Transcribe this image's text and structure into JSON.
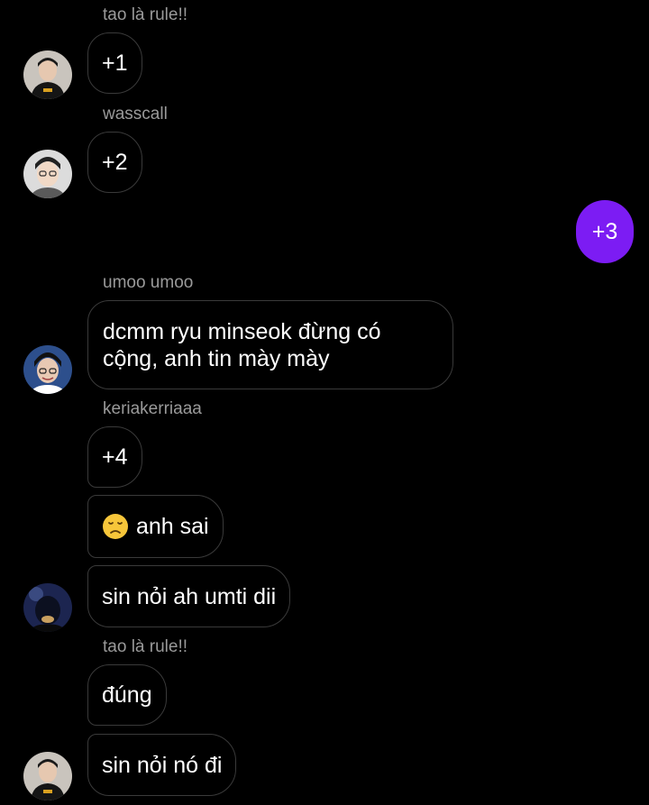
{
  "messages": [
    {
      "sender": "tao là rule!!",
      "text": "+1"
    },
    {
      "sender": "wasscall",
      "text": "+2"
    },
    {
      "outgoing": true,
      "text": "+3"
    },
    {
      "sender": "umoo umoo",
      "text": "dcmm ryu minseok đừng có cộng, anh tin mày mày"
    },
    {
      "sender": "keriakerriaaa",
      "texts": [
        "+4",
        "anh sai",
        "sin nỏi ah umti dii"
      ],
      "emoji": "disappointed-face-icon"
    },
    {
      "sender": "tao là rule!!",
      "texts": [
        "đúng",
        "sin nỏi nó đi"
      ]
    }
  ],
  "colors": {
    "background": "#000000",
    "outgoing_bubble": "#7c1cf3",
    "incoming_border": "#3a3a3a",
    "sender_name": "#9a9a9a"
  }
}
